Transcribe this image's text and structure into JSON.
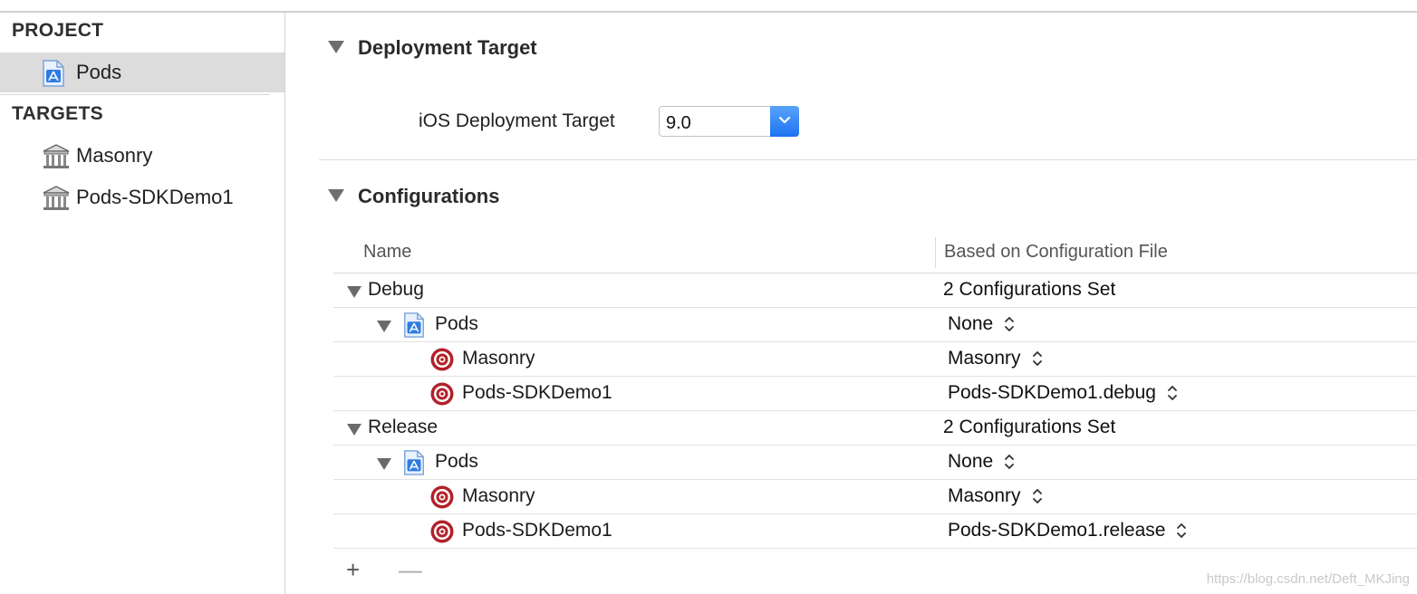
{
  "sidebar": {
    "project_header": "PROJECT",
    "project_item": "Pods",
    "targets_header": "TARGETS",
    "targets": [
      "Masonry",
      "Pods-SDKDemo1"
    ]
  },
  "deployment": {
    "title": "Deployment Target",
    "ios_label": "iOS Deployment Target",
    "ios_value": "9.0"
  },
  "configurations": {
    "title": "Configurations",
    "columns": [
      "Name",
      "Based on Configuration File"
    ],
    "debug": {
      "name": "Debug",
      "summary": "2 Configurations Set",
      "project": {
        "name": "Pods",
        "value": "None"
      },
      "targets": [
        {
          "name": "Masonry",
          "value": "Masonry"
        },
        {
          "name": "Pods-SDKDemo1",
          "value": "Pods-SDKDemo1.debug"
        }
      ]
    },
    "release": {
      "name": "Release",
      "summary": "2 Configurations Set",
      "project": {
        "name": "Pods",
        "value": "None"
      },
      "targets": [
        {
          "name": "Masonry",
          "value": "Masonry"
        },
        {
          "name": "Pods-SDKDemo1",
          "value": "Pods-SDKDemo1.release"
        }
      ]
    },
    "add_label": "+",
    "remove_label": "—"
  },
  "watermark": "https://blog.csdn.net/Deft_MKJing",
  "icons": {
    "project": "xcode-project-icon",
    "target_library": "library-target-icon",
    "target_config": "target-icon",
    "disclosure": "disclosure-triangle-icon",
    "popup": "popup-chevron-icon",
    "stepper": "stepper-updown-icon"
  },
  "colors": {
    "selection": "#dcdcdc",
    "popup_blue": "#1c73f0",
    "target_red": "#b3202a"
  }
}
